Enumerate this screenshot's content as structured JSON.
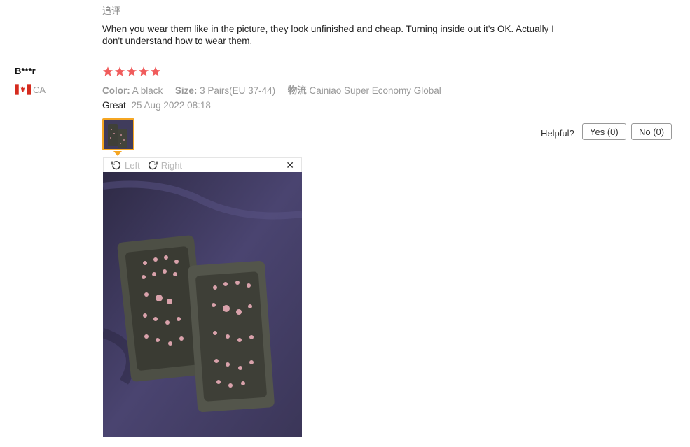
{
  "previous_review": {
    "followup_label": "追评",
    "followup_text": "When you wear them like in the picture, they look unfinished and cheap. Turning inside out it's OK. Actually I don't understand how to wear them."
  },
  "review": {
    "user": "B***r",
    "country": "CA",
    "rating": 5,
    "attributes": {
      "color_label": "Color:",
      "color_value": "A black",
      "size_label": "Size:",
      "size_value": "3 Pairs(EU 37-44)",
      "logistics_label": "物流",
      "logistics_value": "Cainiao Super Economy Global"
    },
    "text": "Great",
    "date": "25 Aug 2022 08:18",
    "helpful_label": "Helpful?",
    "yes_label": "Yes (0)",
    "no_label": "No (0)",
    "viewer": {
      "rotate_left_label": "Left",
      "rotate_right_label": "Right",
      "close_icon": "close-icon"
    }
  },
  "colors": {
    "star": "#f05c5c",
    "thumb_border": "#f5a623",
    "flag_red": "#d52b1e"
  }
}
